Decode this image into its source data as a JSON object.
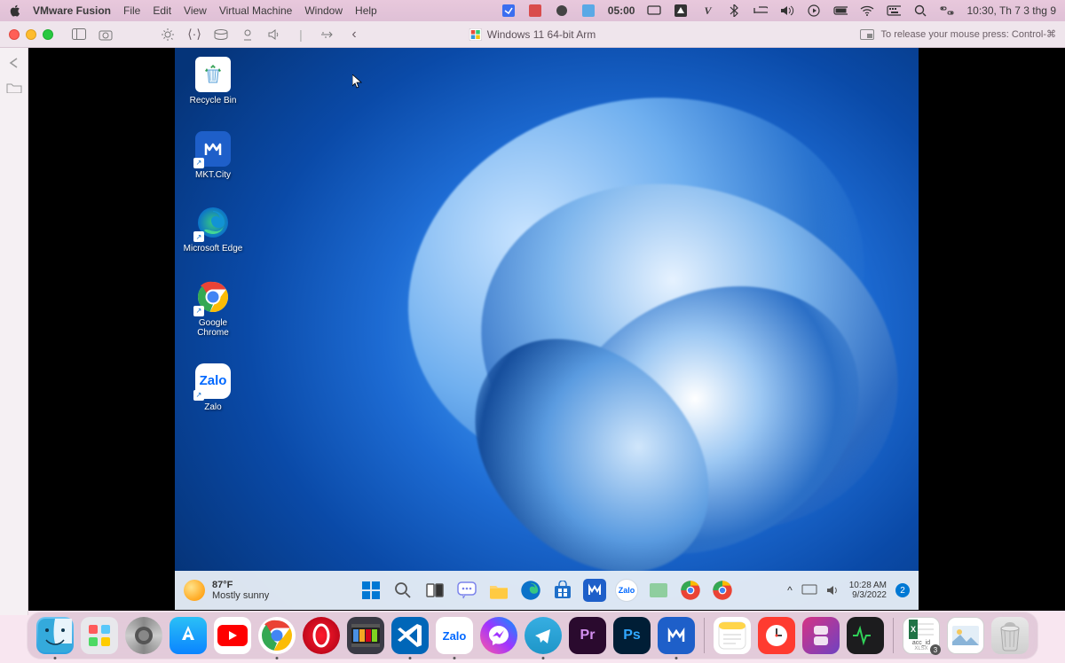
{
  "mac_menubar": {
    "app_name": "VMware Fusion",
    "menus": [
      "File",
      "Edit",
      "View",
      "Virtual Machine",
      "Window",
      "Help"
    ],
    "timer": "05:00",
    "clock": "10:30, Th 7 3 thg 9"
  },
  "vmware_toolbar": {
    "vm_title": "Windows 11 64-bit Arm",
    "hint": "To release your mouse press: Control-⌘"
  },
  "windows": {
    "desktop_icons": [
      {
        "name": "recycle-bin",
        "label": "Recycle Bin"
      },
      {
        "name": "mktcity",
        "label": "MKT.City"
      },
      {
        "name": "microsoft-edge",
        "label": "Microsoft Edge"
      },
      {
        "name": "google-chrome",
        "label": "Google Chrome"
      },
      {
        "name": "zalo",
        "label": "Zalo"
      }
    ],
    "weather": {
      "temp": "87°F",
      "desc": "Mostly sunny"
    },
    "taskbar_time": "10:28 AM",
    "taskbar_date": "9/3/2022",
    "taskbar_badge": "2"
  },
  "dock": {
    "items": [
      "finder",
      "launchpad",
      "settings",
      "appstore",
      "youtube",
      "chrome",
      "opera",
      "fcpx",
      "vscode",
      "zalo",
      "messenger",
      "telegram",
      "premiere",
      "photoshop",
      "mkt"
    ],
    "right_items": [
      "notes",
      "clock-app",
      "shortcuts",
      "activity",
      "downloads",
      "excel",
      "photos",
      "trash"
    ],
    "zalo_label": "Zalo",
    "premiere_label": "Pr",
    "photoshop_label": "Ps",
    "excel_label": "acc_id",
    "excel_sub": "XLSX",
    "excel_badge": "3"
  }
}
